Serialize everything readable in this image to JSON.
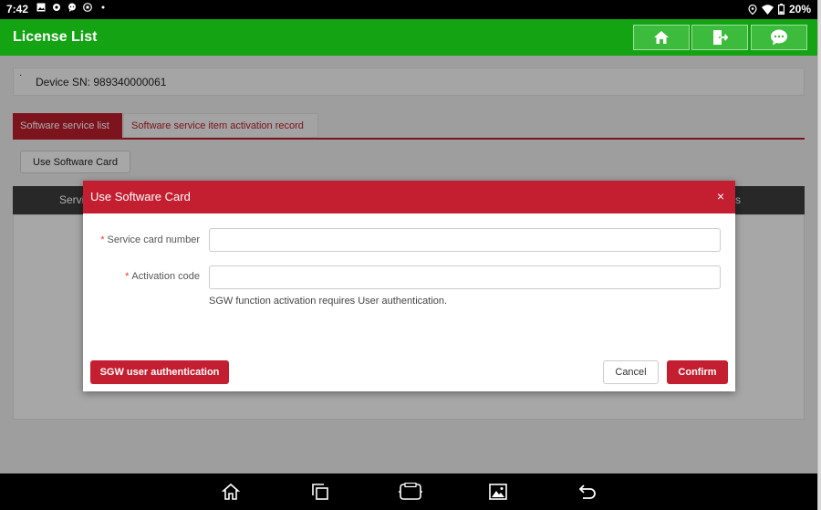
{
  "status_bar": {
    "time": "7:42",
    "battery": "20%",
    "icons": [
      "gallery-icon",
      "gear-icon",
      "chat-icon",
      "vpn-icon",
      "dot-icon",
      "location-icon",
      "wifi-icon",
      "battery-icon"
    ]
  },
  "app": {
    "title": "License List",
    "header_buttons": [
      "home-icon",
      "exit-icon",
      "message-icon"
    ],
    "accent": "#13a313"
  },
  "device": {
    "marker": "·",
    "sn_text": "Device SN: 989340000061"
  },
  "tabs": [
    {
      "label": "Software service list",
      "active": true
    },
    {
      "label": "Software service item activation record",
      "active": false
    }
  ],
  "toolbar": {
    "use_card_label": "Use Software Card"
  },
  "table": {
    "col_left_partial": "Servi",
    "col_right_partial": "s"
  },
  "dialog": {
    "title": "Use Software Card",
    "close_glyph": "×",
    "fields": [
      {
        "label": "Service card number",
        "required": true,
        "value": "",
        "placeholder": ""
      },
      {
        "label": "Activation code",
        "required": true,
        "value": "",
        "placeholder": ""
      }
    ],
    "hint": "SGW function activation requires User authentication.",
    "sgw_button": "SGW user authentication",
    "cancel_button": "Cancel",
    "confirm_button": "Confirm",
    "color": "#c41f30"
  },
  "nav_bar": {
    "icons": [
      "home-icon",
      "recents-icon",
      "vci-icon",
      "screenshot-icon",
      "back-icon"
    ]
  }
}
